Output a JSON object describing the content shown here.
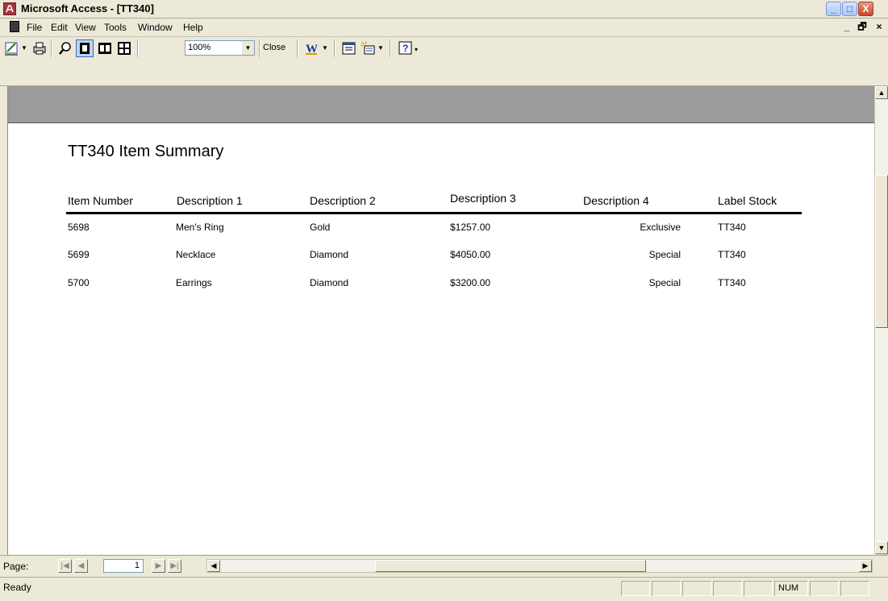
{
  "window": {
    "title": "Microsoft Access - [TT340]",
    "controls": {
      "minimize": "_",
      "maximize": "□",
      "close": "X"
    }
  },
  "menubar": {
    "items": [
      {
        "label": "File",
        "key": "F"
      },
      {
        "label": "Edit",
        "key": "E"
      },
      {
        "label": "View",
        "key": "V"
      },
      {
        "label": "Tools",
        "key": "T"
      },
      {
        "label": "Window",
        "key": "W"
      },
      {
        "label": "Help",
        "key": "H"
      }
    ],
    "mdi_controls": {
      "minimize": "_",
      "restore": "🗗",
      "close": "×"
    }
  },
  "toolbar": {
    "zoom_value": "100%",
    "close_label": "Close",
    "icons": [
      "view-design-icon",
      "print-icon",
      "zoom-icon",
      "one-page-icon",
      "two-pages-icon",
      "multiple-pages-icon",
      "office-links-icon",
      "database-window-icon",
      "new-object-icon",
      "help-icon"
    ]
  },
  "report": {
    "title": "TT340 Item Summary",
    "columns": [
      "Item Number",
      "Description 1",
      "Description 2",
      "Description 3",
      "Description 4",
      "Label Stock"
    ],
    "rows": [
      [
        "5698",
        "Men's Ring",
        "Gold",
        "$1257.00",
        "Exclusive",
        "TT340"
      ],
      [
        "5699",
        "Necklace",
        "Diamond",
        "$4050.00",
        "Special",
        "TT340"
      ],
      [
        "5700",
        "Earrings",
        "Diamond",
        "$3200.00",
        "Special",
        "TT340"
      ]
    ]
  },
  "navigation": {
    "page_label": "Page:",
    "current_page": "1",
    "buttons": {
      "first": "|◀",
      "prev": "◀",
      "next": "▶",
      "last": "▶|"
    }
  },
  "statusbar": {
    "text": "Ready",
    "num_indicator": "NUM"
  },
  "colors": {
    "chrome": "#ece9d8",
    "access_icon": "#a4373a",
    "grey_band": "#9b9b9b"
  }
}
